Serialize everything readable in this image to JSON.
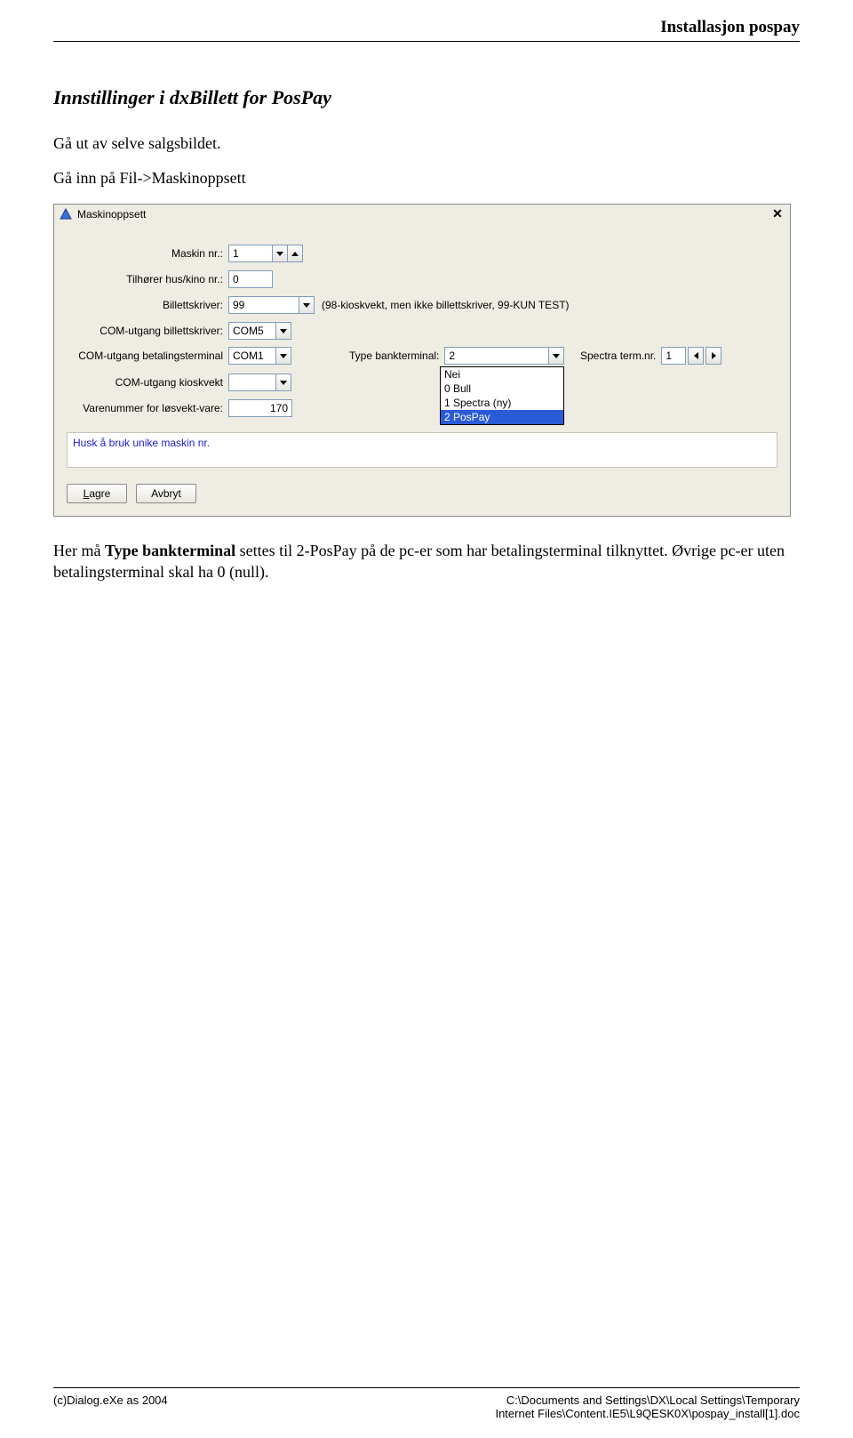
{
  "header": {
    "title": "Installasjon pospay"
  },
  "section": {
    "title": "Innstillinger i dxBillett for PosPay",
    "p1": "Gå ut av selve salgsbildet.",
    "p2": "Gå inn på Fil->Maskinoppsett"
  },
  "window": {
    "title": "Maskinoppsett",
    "labels": {
      "maskin_nr": "Maskin nr.:",
      "tilhorer": "Tilhører hus/kino nr.:",
      "billettskriver": "Billettskriver:",
      "com_billett": "COM-utgang billettskriver:",
      "com_betaling": "COM-utgang betalingsterminal",
      "com_kiosk": "COM-utgang kioskvekt",
      "varenummer": "Varenummer for løsvekt-vare:",
      "type_bank": "Type bankterminal:",
      "spectra": "Spectra term.nr."
    },
    "values": {
      "maskin_nr": "1",
      "tilhorer": "0",
      "billettskriver": "99",
      "billettskriver_note": "(98-kioskvekt, men ikke billettskriver, 99-KUN TEST)",
      "com_billett": "COM5",
      "com_betaling": "COM1",
      "com_kiosk": "",
      "varenummer": "170",
      "type_bank": "2",
      "spectra": "1"
    },
    "dropdown_options": [
      "Nei",
      "0 Bull",
      "1 Spectra (ny)",
      "2 PosPay"
    ],
    "dropdown_selected_index": 3,
    "hint": "Husk å bruk unike maskin nr.",
    "buttons": {
      "save": "Lagre",
      "save_ul": "L",
      "save_rest": "agre",
      "cancel": "Avbryt"
    }
  },
  "after": {
    "line1a": "Her må ",
    "line1b": "Type bankterminal",
    "line1c": " settes til 2-PosPay på de pc-er som har betalingsterminal tilknyttet. Øvrige pc-er uten betalingsterminal skal ha 0 (null)."
  },
  "footer": {
    "left": "(c)Dialog.eXe as 2004",
    "right1": "C:\\Documents and Settings\\DX\\Local Settings\\Temporary",
    "right2": "Internet Files\\Content.IE5\\L9QESK0X\\pospay_install[1].doc"
  }
}
